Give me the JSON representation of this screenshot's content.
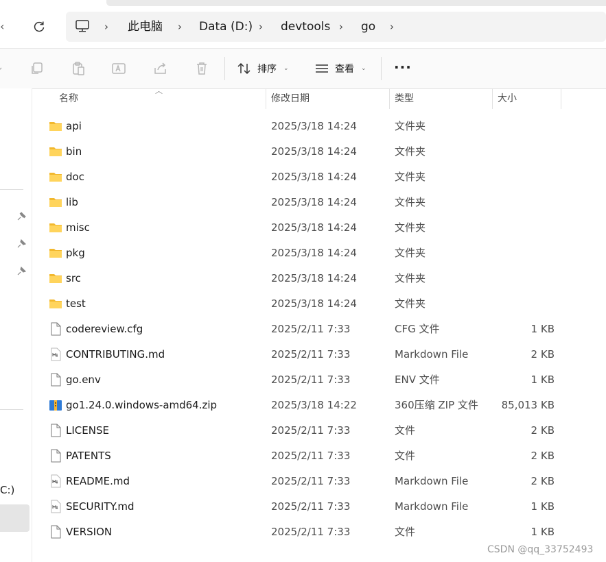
{
  "breadcrumb": {
    "items": [
      "此电脑",
      "Data (D:)",
      "devtools",
      "go"
    ],
    "separator": "›"
  },
  "toolbar": {
    "sort_label": "排序",
    "view_label": "查看",
    "more_label": "···"
  },
  "columns": {
    "name": "名称",
    "date": "修改日期",
    "type": "类型",
    "size": "大小"
  },
  "nav": {
    "drive_fragment": "C:)"
  },
  "files": [
    {
      "name": "api",
      "date": "2025/3/18 14:24",
      "type": "文件夹",
      "size": "",
      "icon": "folder-icon"
    },
    {
      "name": "bin",
      "date": "2025/3/18 14:24",
      "type": "文件夹",
      "size": "",
      "icon": "folder-icon"
    },
    {
      "name": "doc",
      "date": "2025/3/18 14:24",
      "type": "文件夹",
      "size": "",
      "icon": "folder-icon"
    },
    {
      "name": "lib",
      "date": "2025/3/18 14:24",
      "type": "文件夹",
      "size": "",
      "icon": "folder-icon"
    },
    {
      "name": "misc",
      "date": "2025/3/18 14:24",
      "type": "文件夹",
      "size": "",
      "icon": "folder-icon"
    },
    {
      "name": "pkg",
      "date": "2025/3/18 14:24",
      "type": "文件夹",
      "size": "",
      "icon": "folder-icon"
    },
    {
      "name": "src",
      "date": "2025/3/18 14:24",
      "type": "文件夹",
      "size": "",
      "icon": "folder-icon"
    },
    {
      "name": "test",
      "date": "2025/3/18 14:24",
      "type": "文件夹",
      "size": "",
      "icon": "folder-icon"
    },
    {
      "name": "codereview.cfg",
      "date": "2025/2/11 7:33",
      "type": "CFG 文件",
      "size": "1 KB",
      "icon": "file-icon"
    },
    {
      "name": "CONTRIBUTING.md",
      "date": "2025/2/11 7:33",
      "type": "Markdown File",
      "size": "2 KB",
      "icon": "markdown-file-icon"
    },
    {
      "name": "go.env",
      "date": "2025/2/11 7:33",
      "type": "ENV 文件",
      "size": "1 KB",
      "icon": "file-icon"
    },
    {
      "name": "go1.24.0.windows-amd64.zip",
      "date": "2025/3/18 14:22",
      "type": "360压缩 ZIP 文件",
      "size": "85,013 KB",
      "icon": "zip-archive-icon"
    },
    {
      "name": "LICENSE",
      "date": "2025/2/11 7:33",
      "type": "文件",
      "size": "2 KB",
      "icon": "file-icon"
    },
    {
      "name": "PATENTS",
      "date": "2025/2/11 7:33",
      "type": "文件",
      "size": "2 KB",
      "icon": "file-icon"
    },
    {
      "name": "README.md",
      "date": "2025/2/11 7:33",
      "type": "Markdown File",
      "size": "2 KB",
      "icon": "markdown-file-icon"
    },
    {
      "name": "SECURITY.md",
      "date": "2025/2/11 7:33",
      "type": "Markdown File",
      "size": "1 KB",
      "icon": "markdown-file-icon"
    },
    {
      "name": "VERSION",
      "date": "2025/2/11 7:33",
      "type": "文件",
      "size": "1 KB",
      "icon": "file-icon"
    }
  ],
  "watermark": "CSDN @qq_33752493",
  "colors": {
    "folder": "#f5c33b",
    "zip_blue": "#2f7bd6",
    "selected_nav": "#e5e5e5"
  }
}
